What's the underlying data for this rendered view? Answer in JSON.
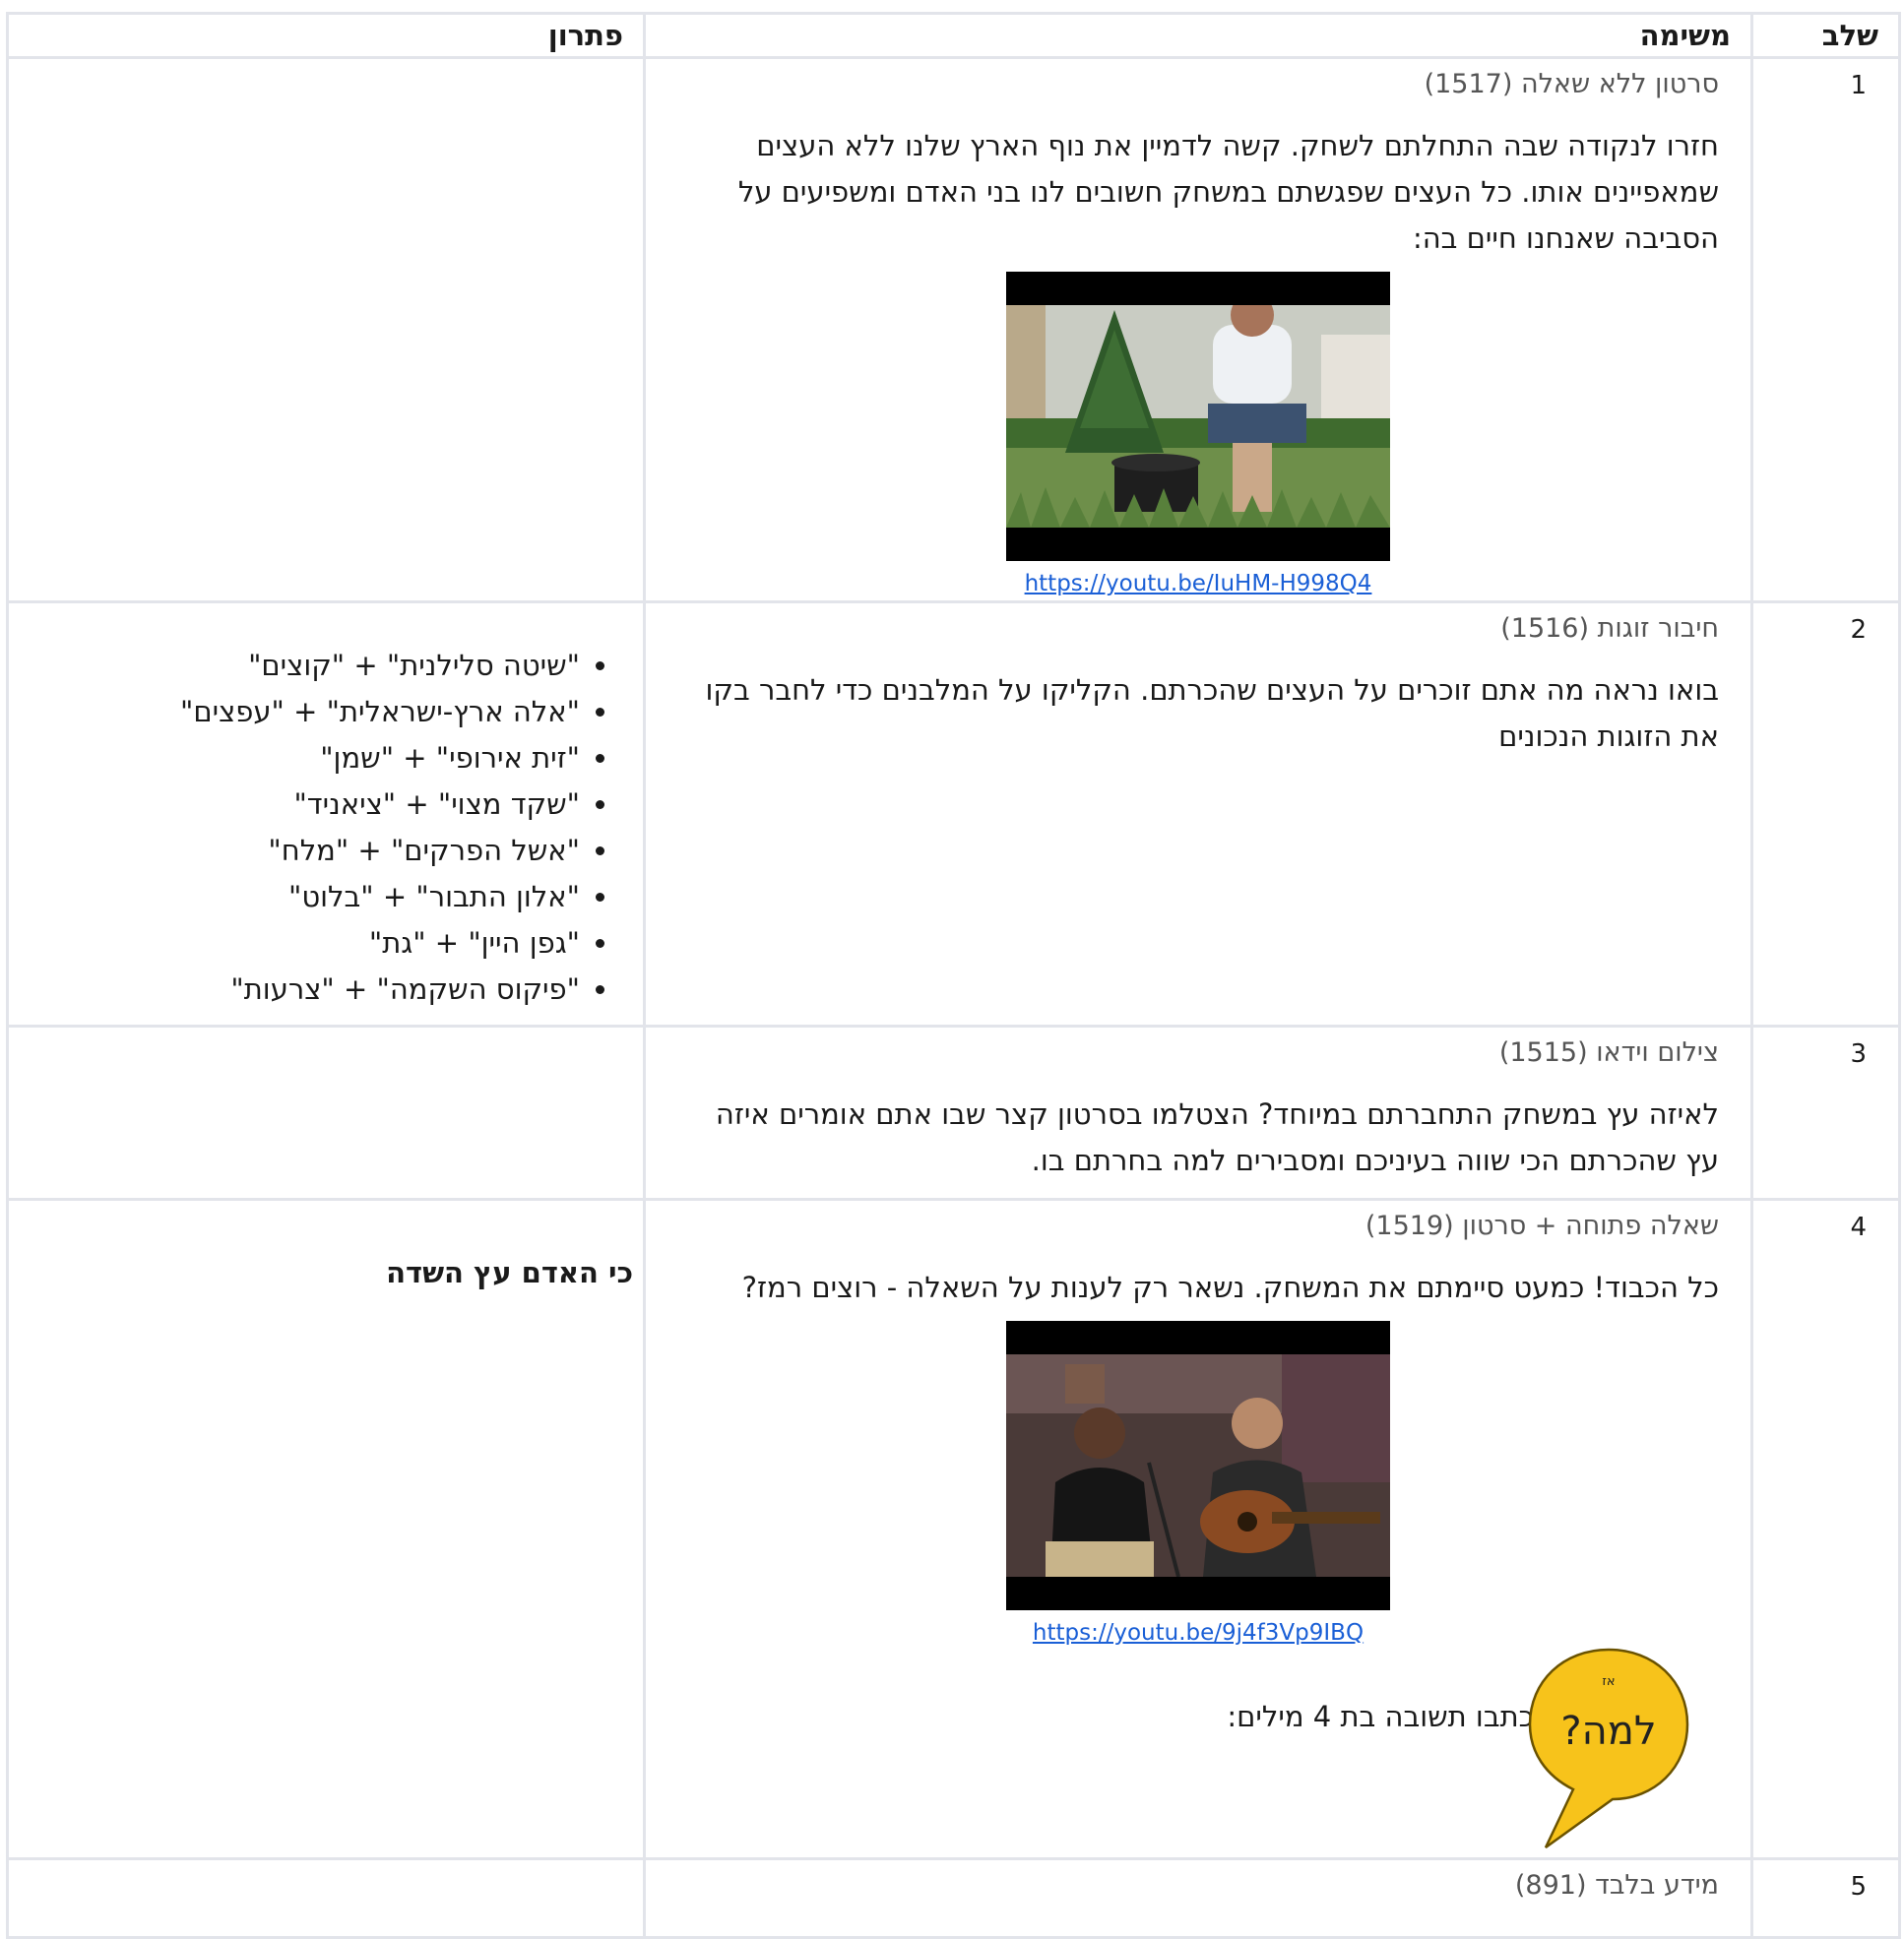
{
  "headers": {
    "step": "שלב",
    "task": "משימה",
    "solution": "פתרון"
  },
  "rows": [
    {
      "step": "1",
      "type": "סרטון ללא שאלה (1517)",
      "text": "חזרו לנקודה שבה התחלתם לשחק. קשה לדמיין את נוף הארץ שלנו ללא העצים שמאפיינים אותו. כל העצים שפגשתם במשחק  חשובים לנו בני האדם ומשפיעים על הסביבה שאנחנו חיים בה:",
      "video_link": "https://youtu.be/IuHM-H998Q4"
    },
    {
      "step": "2",
      "type": "חיבור זוגות (1516)",
      "text": "בואו נראה מה אתם זוכרים על העצים שהכרתם. הקליקו על המלבנים כדי לחבר בקו את הזוגות הנכונים",
      "pairs": [
        "\"שיטה סלילנית\" + \"קוצים\"",
        "\"אלה ארץ-ישראלית\" + \"עפצים\"",
        "\"זית אירופי\" + \"שמן\"",
        "\"שקד מצוי\" + \"ציאניד\"",
        "\"אשל הפרקים\" + \"מלח\"",
        "\"אלון התבור\" + \"בלוט\"",
        "\"גפן היין\" + \"גת\"",
        "\"פיקוס השקמה\" + \"צרעות\""
      ]
    },
    {
      "step": "3",
      "type": "צילום וידאו (1515)",
      "text": "לאיזה עץ במשחק התחברתם במיוחד? הצטלמו בסרטון קצר שבו אתם אומרים איזה עץ שהכרתם הכי שווה בעיניכם ומסבירים למה בחרתם בו."
    },
    {
      "step": "4",
      "type": "שאלה פתוחה + סרטון (1519)",
      "text": "כל הכבוד! כמעט סיימתם את המשחק. נשאר רק לענות על השאלה -  רוצים רמז?",
      "video_link": "https://youtu.be/9j4f3Vp9IBQ",
      "hint_instruction": "כתבו תשובה בת 4 מילים:",
      "bubble_small": "אז",
      "bubble_big": "למה?",
      "answer": "כי האדם עץ השדה"
    },
    {
      "step": "5",
      "type": "מידע בלבד (891)"
    }
  ],
  "colors": {
    "border": "#e2e4ea",
    "link": "#1a5fd6",
    "bubble": "#f7c31b"
  }
}
